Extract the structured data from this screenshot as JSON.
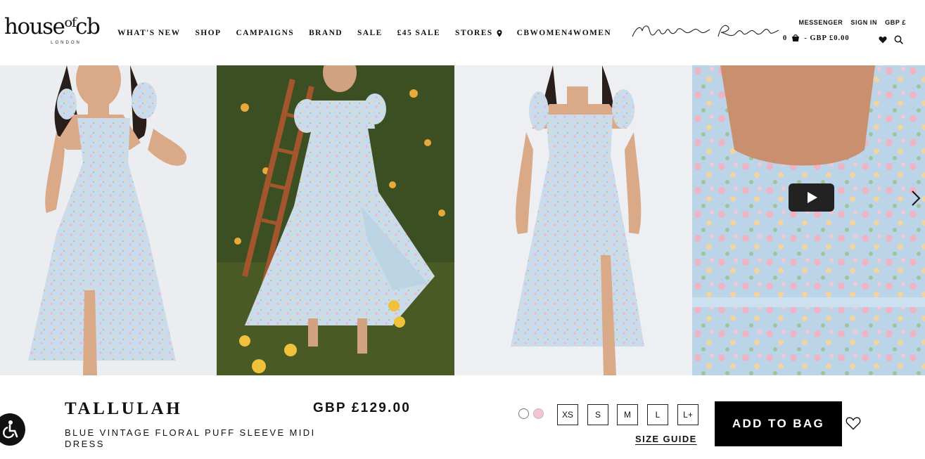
{
  "brand": {
    "name": "house of cb",
    "logo_text": "houseᵒᶠcb",
    "city": "LONDON"
  },
  "nav": {
    "items": [
      "WHAT'S NEW",
      "SHOP",
      "CAMPAIGNS",
      "BRAND",
      "SALE",
      "£45 SALE",
      "STORES",
      "CBWOMEN4WOMEN"
    ]
  },
  "signature": {
    "text": "Mistress Rocks"
  },
  "utility": {
    "messenger": "MESSENGER",
    "sign_in": "SIGN IN",
    "currency": "GBP £",
    "bag_count": "0",
    "bag_total": "- GBP £0.00"
  },
  "gallery": {
    "images": [
      "model-front",
      "model-garden",
      "model-front-2",
      "detail-closeup-video"
    ]
  },
  "product": {
    "title": "TALLULAH",
    "subtitle": "BLUE VINTAGE FLORAL PUFF SLEEVE MIDI DRESS",
    "price": "GBP £129.00",
    "colors": [
      {
        "name": "blue",
        "hex": "#ffffff",
        "selected": true
      },
      {
        "name": "pink",
        "hex": "#f6c2d6",
        "selected": false
      }
    ],
    "sizes": [
      "XS",
      "S",
      "M",
      "L",
      "L+"
    ],
    "size_guide": "SIZE GUIDE",
    "add_to_bag": "ADD TO BAG"
  },
  "colors": {
    "primary": "#000000",
    "background": "#ffffff",
    "garden_green": "#3e5126",
    "dress_blue": "#c9dbed"
  }
}
